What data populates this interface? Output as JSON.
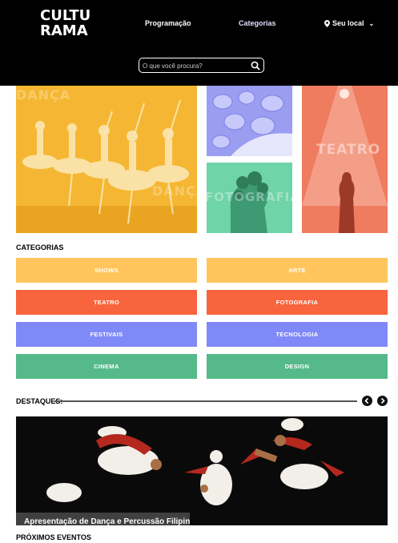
{
  "header": {
    "logo_line1": "CULTU",
    "logo_line2": "RAMA",
    "nav": {
      "programacao": "Programação",
      "categorias": "Categorias",
      "location": "Seu local"
    },
    "search": {
      "placeholder": "O que você procura?"
    }
  },
  "hero": {
    "main_word": "DANÇA",
    "red_word": "TEATRO",
    "green_word": "FOTOGRAFIA"
  },
  "categories": {
    "title": "CATEGORIAS",
    "items": [
      {
        "label": "SHOWS",
        "color": "#FFC55C"
      },
      {
        "label": "ARTE",
        "color": "#FFC55C"
      },
      {
        "label": "TEATRO",
        "color": "#F8643D"
      },
      {
        "label": "FOTOGRAFIA",
        "color": "#F8643D"
      },
      {
        "label": "FESTIVAIS",
        "color": "#8089F8"
      },
      {
        "label": "TECNOLOGIA",
        "color": "#8089F8"
      },
      {
        "label": "CINEMA",
        "color": "#55B98A"
      },
      {
        "label": "DESIGN",
        "color": "#55B98A"
      }
    ]
  },
  "destaques": {
    "title": "DESTAQUES:",
    "caption": "Apresentação de Dança e Percussão Filipina"
  },
  "proximos": {
    "title": "PRÓXIMOS EVENTOS"
  }
}
